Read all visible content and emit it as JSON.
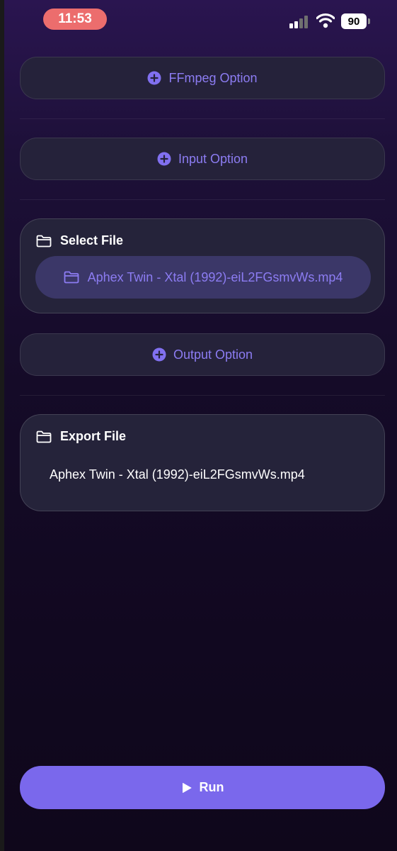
{
  "status_bar": {
    "time": "11:53",
    "battery": "90"
  },
  "options": {
    "ffmpeg_label": "FFmpeg Option",
    "input_label": "Input Option",
    "output_label": "Output Option"
  },
  "select_file": {
    "title": "Select File",
    "file_name": "Aphex Twin - Xtal (1992)-eiL2FGsmvWs.mp4"
  },
  "export_file": {
    "title": "Export File",
    "file_name": "Aphex Twin - Xtal (1992)-eiL2FGsmvWs.mp4"
  },
  "run": {
    "label": "Run"
  },
  "colors": {
    "accent": "#7a68ec",
    "accent_text": "#8c7cf2",
    "card_bg": "#25233a",
    "time_pill": "#ec6d6d"
  },
  "icons": {
    "option": "plus-circle-icon",
    "file": "folder-icon",
    "run": "play-icon"
  }
}
